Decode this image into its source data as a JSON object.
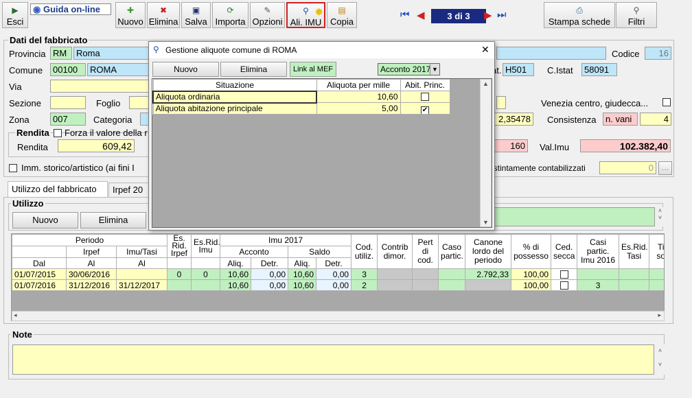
{
  "toolbar": {
    "esci": "Esci",
    "guida": "Guida on-line",
    "nuovo": "Nuovo",
    "elimina": "Elimina",
    "salva": "Salva",
    "importa": "Importa",
    "opzioni": "Opzioni",
    "ali_imu": "Ali. IMU",
    "copia": "Copia",
    "counter": "3 di 3",
    "stampa": "Stampa schede",
    "filtri": "Filtri"
  },
  "section": {
    "title": "Dati del fabbricato"
  },
  "form": {
    "provincia_label": "Provincia",
    "provincia_code": "RM",
    "provincia_name": "Roma",
    "codice_label": "Codice",
    "codice_value": "16",
    "comune_label": "Comune",
    "comune_code": "00100",
    "comune_name": "ROMA",
    "cat_label": "at.",
    "cat_value": "H501",
    "istat_label": "C.Istat",
    "istat_value": "58091",
    "via_label": "Via",
    "sezione_label": "Sezione",
    "foglio_label": "Foglio",
    "venezia_label": "Venezia centro, giudecca...",
    "zona_label": "Zona",
    "zona_value": "007",
    "categoria_label": "Categoria",
    "partial_value": "2,35478",
    "consistenza_label": "Consistenza",
    "consistenza_unit": "n. vani",
    "consistenza_value": "4",
    "rendita_group": "Rendita",
    "forza_label": "Forza il valore della r",
    "rendita_label": "Rendita",
    "rendita_value": "609,42",
    "pink_value": "160",
    "valimu_label": "Val.Imu",
    "valimu_value": "102.382,40",
    "storico_label": "Imm. storico/artistico (ai fini I",
    "contab_label": "istintamente contabilizzati",
    "contab_value": "0",
    "ellipsis": "..."
  },
  "tabs": {
    "utilizzo": "Utilizzo del fabbricato",
    "irpef": "Irpef 20"
  },
  "utilizzo": {
    "title": "Utilizzo",
    "nuovo": "Nuovo",
    "elimina": "Elimina"
  },
  "grid": {
    "h_periodo": "Periodo",
    "h_irpef": "Irpef",
    "h_imutasi": "Imu/Tasi",
    "h_dal": "Dal",
    "h_al1": "Al",
    "h_al2": "Al",
    "h_esrid_irpef": "Es. Rid. Irpef",
    "h_esrid_imu": "Es.Rid. Imu",
    "h_imu2017": "Imu 2017",
    "h_acconto": "Acconto",
    "h_saldo": "Saldo",
    "h_aliq1": "Aliq.",
    "h_detr1": "Detr.",
    "h_aliq2": "Aliq.",
    "h_detr2": "Detr.",
    "h_codutil": "Cod. utiliz.",
    "h_contrib": "Contrib dimor.",
    "h_pert": "Pert di cod.",
    "h_caso": "Caso partic.",
    "h_canone": "Canone lordo del periodo",
    "h_possesso": "% di possesso",
    "h_ced": "Ced. secca",
    "h_casi2016": "Casi partic. Imu 2016",
    "h_esridtasi": "Es.Rid. Tasi",
    "h_tipo": "Tip sog",
    "rows": [
      {
        "dal": "01/07/2015",
        "al1": "30/06/2016",
        "al2": "",
        "esrid_irpef": "0",
        "esrid_imu": "0",
        "aliq1": "10,60",
        "detr1": "0,00",
        "aliq2": "10,60",
        "detr2": "0,00",
        "cod": "3",
        "canone": "2.792,33",
        "possesso": "100,00",
        "casi": ""
      },
      {
        "dal": "01/07/2016",
        "al1": "31/12/2016",
        "al2": "31/12/2017",
        "esrid_irpef": "",
        "esrid_imu": "",
        "aliq1": "10,60",
        "detr1": "0,00",
        "aliq2": "10,60",
        "detr2": "0,00",
        "cod": "2",
        "canone": "",
        "possesso": "100,00",
        "casi": "3"
      }
    ]
  },
  "note": {
    "title": "Note"
  },
  "modal": {
    "title": "Gestione aliquote comune di ROMA",
    "close": "✕",
    "nuovo": "Nuovo",
    "elimina": "Elimina",
    "link": "Link al MEF",
    "select": "Acconto 2017",
    "h_situazione": "Situazione",
    "h_aliquota": "Aliquota per mille",
    "h_abit": "Abit. Princ.",
    "rows": [
      {
        "situazione": "Aliquota ordinaria",
        "aliquota": "10,60",
        "abit": ""
      },
      {
        "situazione": "Aliquota abitazione principale",
        "aliquota": "5,00",
        "abit": "✔"
      }
    ]
  }
}
